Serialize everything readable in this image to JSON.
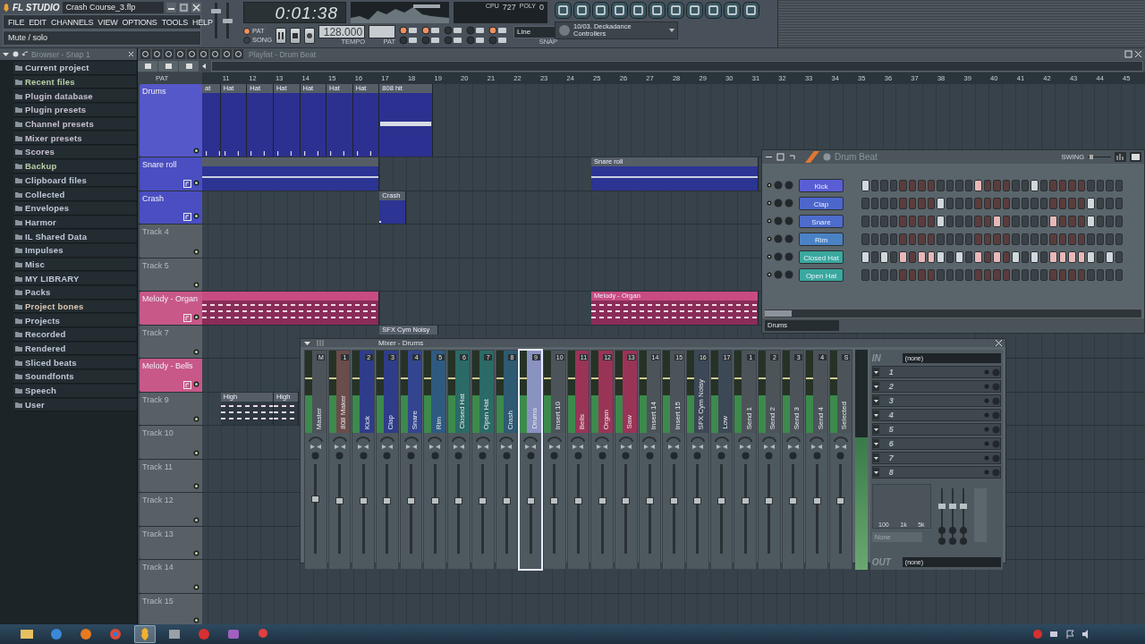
{
  "window": {
    "logo": "FL STUDIO",
    "file": "Crash Course_3.flp"
  },
  "menu": [
    "FILE",
    "EDIT",
    "CHANNELS",
    "VIEW",
    "OPTIONS",
    "TOOLS",
    "HELP"
  ],
  "hint": "Mute / solo",
  "master_sliders": [
    {
      "level": 0.8
    },
    {
      "level": 0.5
    }
  ],
  "transport": {
    "time": "0:01:38",
    "modes": [
      {
        "label": "PAT",
        "selected": true
      },
      {
        "label": "SONG",
        "selected": false
      }
    ],
    "tempo": "128.000",
    "tempo_label": "TEMPO",
    "pattern_label": "PAT",
    "snap": "Line",
    "snap_label": "SNAP",
    "cpu_label": "CPU",
    "cpu_value": "727",
    "poly_label": "POLY",
    "poly_value": "0"
  },
  "plugin_picker": {
    "line1": "10/03. Deckadance",
    "line2": "Controllers"
  },
  "browser": {
    "title": "Browser - Snap 1",
    "items": [
      {
        "label": "Current project",
        "color": "#c8ccd4"
      },
      {
        "label": "Recent files",
        "color": "#b8d0a8"
      },
      {
        "label": "Plugin database",
        "color": "#c8c0d0"
      },
      {
        "label": "Plugin presets",
        "color": "#c8c0d0"
      },
      {
        "label": "Channel presets",
        "color": "#c8c0d0"
      },
      {
        "label": "Mixer presets",
        "color": "#c8c0d0"
      },
      {
        "label": "Scores",
        "color": "#c8c0d0"
      },
      {
        "label": "Backup",
        "color": "#b8d0a8"
      },
      {
        "label": "Clipboard files",
        "color": "#c0c8d8"
      },
      {
        "label": "Collected",
        "color": "#c0c8d8"
      },
      {
        "label": "Envelopes",
        "color": "#c0c8d8"
      },
      {
        "label": "Harmor",
        "color": "#c0c8d8"
      },
      {
        "label": "IL Shared Data",
        "color": "#c0c8d8"
      },
      {
        "label": "Impulses",
        "color": "#c0c8d8"
      },
      {
        "label": "Misc",
        "color": "#c0c8d8"
      },
      {
        "label": "MY LIBRARY",
        "color": "#c0c8d8"
      },
      {
        "label": "Packs",
        "color": "#c0c8d8"
      },
      {
        "label": "Project bones",
        "color": "#dcc8b0"
      },
      {
        "label": "Projects",
        "color": "#c0c8d8"
      },
      {
        "label": "Recorded",
        "color": "#c0c8d8"
      },
      {
        "label": "Rendered",
        "color": "#c0c8d8"
      },
      {
        "label": "Sliced beats",
        "color": "#c0c8d8"
      },
      {
        "label": "Soundfonts",
        "color": "#c0c8d8"
      },
      {
        "label": "Speech",
        "color": "#c0c8d8"
      },
      {
        "label": "User",
        "color": "#c0c8d8"
      }
    ]
  },
  "playlist": {
    "title": "Playlist - Drum Beat",
    "view_label": "PAT",
    "ruler": [
      "11",
      "12",
      "13",
      "14",
      "15",
      "16",
      "17",
      "18",
      "19",
      "20",
      "21",
      "22",
      "23",
      "24",
      "25",
      "26",
      "27",
      "28",
      "29",
      "30",
      "31",
      "32",
      "33",
      "34",
      "35",
      "36",
      "37",
      "38",
      "39",
      "40",
      "41",
      "42",
      "43",
      "44",
      "45"
    ],
    "tracks": [
      {
        "name": "Drums",
        "color": "#5558c8",
        "tall": true,
        "clips": [
          {
            "label": "at",
            "kind": "hats",
            "color": "#2c3090"
          },
          {
            "label": "Hat",
            "kind": "hats",
            "color": "#2c3090"
          },
          {
            "label": "Hat",
            "kind": "hats",
            "color": "#2c3090"
          },
          {
            "label": "Hat",
            "kind": "hats",
            "color": "#2c3090"
          },
          {
            "label": "Hat",
            "kind": "hats",
            "color": "#2c3090"
          },
          {
            "label": "Hat",
            "kind": "hats",
            "color": "#2c3090"
          },
          {
            "label": "Hat",
            "kind": "hats",
            "color": "#2c3090"
          },
          {
            "label": "808 hit",
            "kind": "hit",
            "color": "#2c3090"
          }
        ]
      },
      {
        "name": "Snare roll",
        "color": "#4a4ec0",
        "clips": [
          {
            "kind": "roll",
            "color": "#2c3494"
          },
          {
            "label": "Snare roll",
            "kind": "roll",
            "color": "#2c3494"
          }
        ]
      },
      {
        "name": "Crash",
        "color": "#4a4ec0",
        "clips": [
          {
            "label": "Crash",
            "kind": "block",
            "color": "#2c3494"
          }
        ]
      },
      {
        "name": "Track 4",
        "color": "#586066"
      },
      {
        "name": "Track 5",
        "color": "#586066"
      },
      {
        "name": "Melody - Organ",
        "color": "#c85888",
        "clips": [
          {
            "kind": "notes",
            "color": "#8a2c58"
          },
          {
            "label": "Melody - Organ",
            "kind": "notes",
            "color": "#8a2c58"
          }
        ]
      },
      {
        "name": "Track 7",
        "color": "#586066",
        "clips": [
          {
            "label": "SFX Cym Noisy",
            "kind": "header"
          }
        ]
      },
      {
        "name": "Melody - Bells",
        "color": "#c85888"
      },
      {
        "name": "Track 9",
        "color": "#586066",
        "clips": [
          {
            "label": "High",
            "kind": "notes",
            "color": "#2e3840"
          },
          {
            "label": "High",
            "kind": "notes",
            "color": "#2e3840"
          }
        ]
      },
      {
        "name": "Track 10",
        "color": "#586066"
      },
      {
        "name": "Track 11",
        "color": "#586066"
      },
      {
        "name": "Track 12",
        "color": "#586066"
      },
      {
        "name": "Track 13",
        "color": "#586066"
      },
      {
        "name": "Track 14",
        "color": "#586066"
      },
      {
        "name": "Track 15",
        "color": "#586066"
      }
    ]
  },
  "stepseq": {
    "title": "Drum Beat",
    "swing": "SWING",
    "filter": "Drums",
    "channels": [
      {
        "name": "Kick",
        "color": "#5a5ed4",
        "steps": [
          true,
          false,
          false,
          false,
          false,
          false,
          false,
          false,
          false,
          false,
          false,
          false,
          true,
          false,
          false,
          false,
          false,
          false,
          true,
          false,
          false,
          false,
          false,
          false,
          false,
          false,
          false,
          false
        ]
      },
      {
        "name": "Clap",
        "color": "#4d66cc",
        "steps": [
          false,
          false,
          false,
          false,
          false,
          false,
          false,
          false,
          true,
          false,
          false,
          false,
          false,
          false,
          false,
          false,
          false,
          false,
          false,
          false,
          false,
          false,
          false,
          false,
          true,
          false,
          false,
          false
        ]
      },
      {
        "name": "Snare",
        "color": "#4d6ccc",
        "steps": [
          false,
          false,
          false,
          false,
          false,
          false,
          false,
          false,
          true,
          false,
          false,
          false,
          false,
          false,
          true,
          false,
          false,
          false,
          false,
          false,
          true,
          false,
          false,
          false,
          true,
          false,
          false,
          false
        ]
      },
      {
        "name": "Rim",
        "color": "#4a82c4",
        "steps": [
          false,
          false,
          false,
          false,
          false,
          false,
          false,
          false,
          false,
          false,
          false,
          false,
          false,
          false,
          false,
          false,
          false,
          false,
          false,
          false,
          false,
          false,
          false,
          false,
          false,
          false,
          false,
          false
        ]
      },
      {
        "name": "Closed Hat",
        "color": "#3aa89e",
        "steps": [
          true,
          false,
          true,
          false,
          true,
          false,
          true,
          true,
          true,
          false,
          true,
          false,
          true,
          false,
          true,
          false,
          true,
          false,
          true,
          false,
          true,
          true,
          true,
          true,
          true,
          false,
          true,
          false
        ]
      },
      {
        "name": "Open Hat",
        "color": "#3aa89e",
        "steps": [
          false,
          false,
          false,
          false,
          false,
          false,
          false,
          false,
          false,
          false,
          false,
          false,
          false,
          false,
          false,
          false,
          false,
          false,
          false,
          false,
          false,
          false,
          false,
          false,
          false,
          false,
          false,
          false
        ]
      }
    ]
  },
  "mixer": {
    "title": "Mixer - Drums",
    "strips": [
      {
        "name": "Master",
        "number": "M",
        "color": "#4c545a",
        "selected": false,
        "level": 0.62
      },
      {
        "name": "808 Maker",
        "number": "1",
        "color": "#6a4c4a",
        "selected": false,
        "level": 0.6
      },
      {
        "name": "Kick",
        "number": "2",
        "color": "#2f3c8a",
        "selected": false,
        "level": 0.6
      },
      {
        "name": "Clap",
        "number": "3",
        "color": "#2f3c8a",
        "selected": false,
        "level": 0.6
      },
      {
        "name": "Snare",
        "number": "4",
        "color": "#33458e",
        "selected": false,
        "level": 0.6
      },
      {
        "name": "Rim",
        "number": "5",
        "color": "#2f5a80",
        "selected": false,
        "level": 0.6
      },
      {
        "name": "Closed Hat",
        "number": "6",
        "color": "#2b6a66",
        "selected": false,
        "level": 0.6
      },
      {
        "name": "Open Hat",
        "number": "7",
        "color": "#2b6a66",
        "selected": false,
        "level": 0.6
      },
      {
        "name": "Crash",
        "number": "8",
        "color": "#2e5a72",
        "selected": false,
        "level": 0.6
      },
      {
        "name": "Drums",
        "number": "9",
        "color": "#8a92c0",
        "selected": true,
        "level": 0.6
      },
      {
        "name": "Insert 10",
        "number": "10",
        "color": "#4c545a",
        "selected": false,
        "level": 0.6
      },
      {
        "name": "Bells",
        "number": "11",
        "color": "#9a3456",
        "selected": false,
        "level": 0.6
      },
      {
        "name": "Organ",
        "number": "12",
        "color": "#9a3456",
        "selected": false,
        "level": 0.6
      },
      {
        "name": "Saw",
        "number": "13",
        "color": "#9a3456",
        "selected": false,
        "level": 0.6
      },
      {
        "name": "Insert 14",
        "number": "14",
        "color": "#4c545a",
        "selected": false,
        "level": 0.6
      },
      {
        "name": "Insert 15",
        "number": "15",
        "color": "#4c545a",
        "selected": false,
        "level": 0.6
      },
      {
        "name": "SFX Cym Noisy",
        "number": "16",
        "color": "#3c4856",
        "selected": false,
        "level": 0.6
      },
      {
        "name": "Low",
        "number": "17",
        "color": "#3c4856",
        "selected": false,
        "level": 0.6
      },
      {
        "name": "Send 1",
        "number": "1",
        "color": "#4c545a",
        "selected": false,
        "level": 0.6
      },
      {
        "name": "Send 2",
        "number": "2",
        "color": "#4c545a",
        "selected": false,
        "level": 0.6
      },
      {
        "name": "Send 3",
        "number": "3",
        "color": "#4c545a",
        "selected": false,
        "level": 0.6
      },
      {
        "name": "Send 4",
        "number": "4",
        "color": "#4c545a",
        "selected": false,
        "level": 0.6
      },
      {
        "name": "Selected",
        "number": "S",
        "color": "#4c545a",
        "selected": false,
        "level": 0.6
      }
    ],
    "in_label": "IN",
    "in_value": "(none)",
    "slots": [
      "1",
      "2",
      "3",
      "4",
      "5",
      "6",
      "7",
      "8"
    ],
    "eq_labels": [
      "100",
      "1k",
      "5k"
    ],
    "preset": "None",
    "out_label": "OUT",
    "out_value": "(none)"
  },
  "taskbar": {
    "apps": [
      {
        "kind": "folder",
        "selected": false
      },
      {
        "kind": "ie",
        "selected": false
      },
      {
        "kind": "firefox",
        "selected": false
      },
      {
        "kind": "chrome",
        "selected": false
      },
      {
        "kind": "fl",
        "selected": true
      },
      {
        "kind": "dark",
        "selected": false
      },
      {
        "kind": "red",
        "selected": false
      },
      {
        "kind": "purple",
        "selected": false
      },
      {
        "kind": "pin",
        "selected": false
      }
    ]
  }
}
